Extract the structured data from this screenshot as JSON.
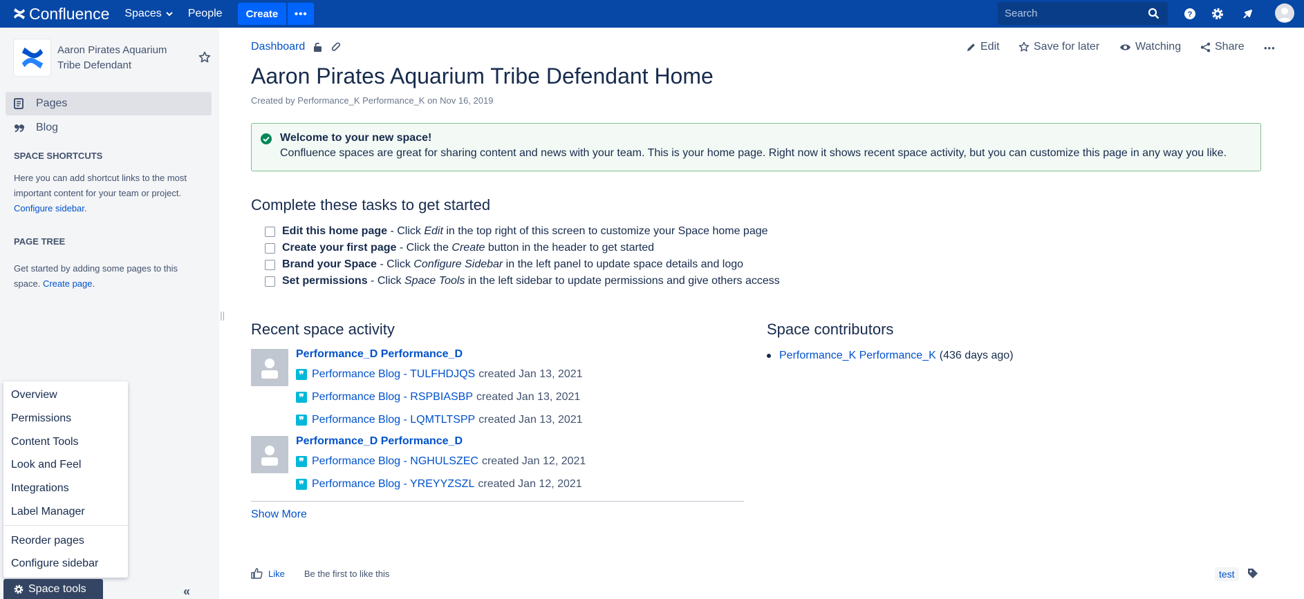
{
  "colors": {
    "brand": "#0747a6",
    "create": "#0065ff",
    "link": "#0052cc",
    "sidebar": "#f4f5f7",
    "success_border": "#7fbf8f",
    "success_bg": "#f3f9f4",
    "blog_icon": "#00b8d9"
  },
  "topbar": {
    "brand": "Confluence",
    "spaces_label": "Spaces",
    "people_label": "People",
    "create_label": "Create",
    "more_label": "•••",
    "search_placeholder": "Search",
    "icons": [
      "help-icon",
      "settings-icon",
      "notifications-icon",
      "profile-avatar"
    ]
  },
  "sidebar": {
    "space_name": "Aaron Pirates Aquarium Tribe Defendant",
    "nav": [
      {
        "label": "Pages",
        "icon": "pages-icon",
        "active": true
      },
      {
        "label": "Blog",
        "icon": "quote-icon",
        "active": false
      }
    ],
    "shortcuts_heading": "SPACE SHORTCUTS",
    "shortcuts_text": "Here you can add shortcut links to the most important content for your team or project.",
    "configure_link": "Configure sidebar",
    "page_tree_heading": "PAGE TREE",
    "page_tree_text": "Get started by adding some pages to this space.",
    "create_page_link": "Create page",
    "menu": [
      "Overview",
      "Permissions",
      "Content Tools",
      "Look and Feel",
      "Integrations",
      "Label Manager",
      "Reorder pages",
      "Configure sidebar"
    ],
    "space_tools_label": "Space tools",
    "resize_glyph": "||",
    "collapse_glyph": "«"
  },
  "main": {
    "breadcrumb": "Dashboard",
    "actions": {
      "edit": "Edit",
      "save": "Save for later",
      "watching": "Watching",
      "share": "Share",
      "more": "•••"
    },
    "title": "Aaron Pirates Aquarium Tribe Defendant Home",
    "byline": "Created by Performance_K Performance_K on Nov 16, 2019",
    "welcome": {
      "title": "Welcome to your new space!",
      "body": "Confluence spaces are great for sharing content and news with your team. This is your home page. Right now it shows recent space activity, but you can customize this page in any way you like."
    },
    "tasks_heading": "Complete these tasks to get started",
    "tasks": [
      {
        "bold": "Edit this home page",
        "p1": " - Click ",
        "em": "Edit",
        "p2": " in the top right of this screen to customize your Space home page"
      },
      {
        "bold": "Create your first page",
        "p1": " - Click the ",
        "em": "Create",
        "p2": " button in the header to get started"
      },
      {
        "bold": "Brand your Space",
        "p1": " - Click ",
        "em": "Configure Sidebar",
        "p2": " in the left panel to update space details and logo"
      },
      {
        "bold": "Set permissions",
        "p1": " - Click ",
        "em": "Space Tools",
        "p2": " in the left sidebar to update permissions and give others access"
      }
    ],
    "activity_heading": "Recent space activity",
    "activity": [
      {
        "user": "Performance_D Performance_D",
        "items": [
          {
            "title": "Performance Blog - TULFHDJQS",
            "meta": "created Jan 13, 2021"
          },
          {
            "title": "Performance Blog - RSPBIASBP",
            "meta": "created Jan 13, 2021"
          },
          {
            "title": "Performance Blog - LQMTLTSPP",
            "meta": "created Jan 13, 2021"
          }
        ]
      },
      {
        "user": "Performance_D Performance_D",
        "items": [
          {
            "title": "Performance Blog - NGHULSZEC",
            "meta": "created Jan 12, 2021"
          },
          {
            "title": "Performance Blog - YREYYZSZL",
            "meta": "created Jan 12, 2021"
          }
        ]
      }
    ],
    "blog_glyph": "❞",
    "show_more": "Show More",
    "contributors_heading": "Space contributors",
    "contributor": {
      "name": "Performance_K Performance_K",
      "meta": "(436 days ago)"
    },
    "like_label": "Like",
    "like_hint": "Be the first to like this",
    "tag": "test"
  }
}
